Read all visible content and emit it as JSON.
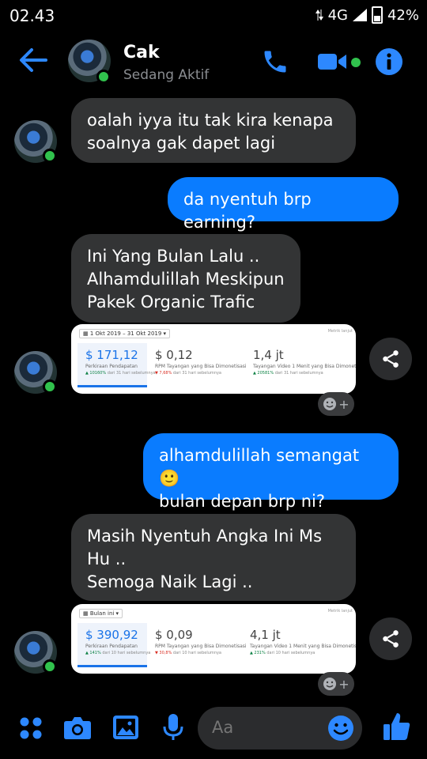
{
  "status_bar": {
    "time": "02.43",
    "network": "4G",
    "battery": "42%"
  },
  "header": {
    "name": "Cak",
    "status": "Sedang Aktif"
  },
  "messages": [
    {
      "text_lines": [
        "oalah iyya itu tak kira kenapa",
        "soalnya gak dapet lagi"
      ]
    },
    {
      "text": "da nyentuh brp earning?"
    },
    {
      "text_lines": [
        "Ini Yang Bulan Lalu ..",
        "Alhamdulillah Meskipun",
        "Pakek Organic Trafic"
      ]
    },
    {
      "card": {
        "range": "1 Okt 2019 – 31 Okt 2019",
        "link": "Metrik lanjut",
        "metrics": [
          {
            "value": "$ 171,12",
            "label": "Perkiraan Pendapatan",
            "change": "▲ 10160%",
            "compare": "dari 31 hari sebelumnya",
            "trend": "up"
          },
          {
            "value": "$ 0,12",
            "label": "RPM Tayangan yang Bisa Dimonetisasi",
            "change": "▼ 7,68%",
            "compare": "dari 31 hari sebelumnya",
            "trend": "down"
          },
          {
            "value": "1,4 jt",
            "label": "Tayangan Video 1 Menit yang Bisa Dimonetisasi",
            "change": "▲ 20581%",
            "compare": "dari 31 hari sebelumnya",
            "trend": "up"
          }
        ]
      }
    },
    {
      "text_lines": [
        "alhamdulillah semangat 🙂",
        "bulan depan brp ni?"
      ]
    },
    {
      "text_lines": [
        "Masih Nyentuh Angka Ini Ms",
        "Hu ..",
        "Semoga Naik Lagi .."
      ]
    },
    {
      "card": {
        "range": "Bulan ini",
        "link": "Metrik lanjut",
        "metrics": [
          {
            "value": "$ 390,92",
            "label": "Perkiraan Pendapatan",
            "change": "▲ 141%",
            "compare": "dari 10 hari sebelumnya",
            "trend": "up"
          },
          {
            "value": "$ 0,09",
            "label": "RPM Tayangan yang Bisa Dimonetisasi",
            "change": "▼ 30,8%",
            "compare": "dari 10 hari sebelumnya",
            "trend": "down"
          },
          {
            "value": "4,1 jt",
            "label": "Tayangan Video 1 Menit yang Bisa Dimonetisasi",
            "change": "▲ 231%",
            "compare": "dari 10 hari sebelumnya",
            "trend": "up"
          }
        ]
      }
    }
  ],
  "composer": {
    "placeholder": "Aa"
  },
  "colors": {
    "accent": "#0a7cff",
    "incoming": "#333435",
    "online": "#31c24d"
  }
}
